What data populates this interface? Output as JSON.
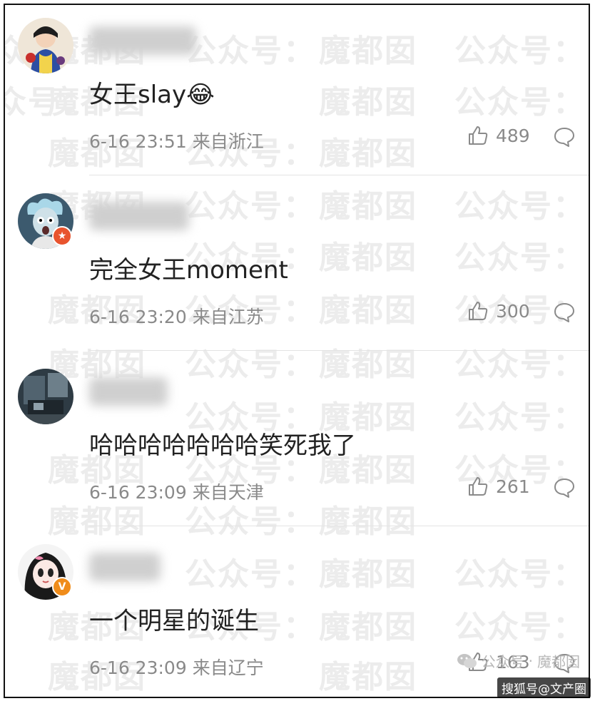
{
  "watermark": {
    "text_a": "魔都囡",
    "text_b": "公众号："
  },
  "comments": [
    {
      "text": "女王slay😂",
      "date": "6-16 23:51",
      "location": "来自浙江",
      "likes": "489",
      "badge": ""
    },
    {
      "text": "完全女王moment",
      "date": "6-16 23:20",
      "location": "来自江苏",
      "likes": "300",
      "badge": "★"
    },
    {
      "text": "哈哈哈哈哈哈哈笑死我了",
      "date": "6-16 23:09",
      "location": "来自天津",
      "likes": "261",
      "badge": ""
    },
    {
      "text": "一个明星的诞生",
      "date": "6-16 23:09",
      "location": "来自辽宁",
      "likes": "163",
      "badge": "V"
    }
  ],
  "footer": {
    "account_label": "公众号",
    "account_name": "魔都囡",
    "source": "搜狐号@文产圈"
  },
  "colors": {
    "badge_red": "#e8542e",
    "badge_orange": "#f08c1a",
    "text_main": "#222222",
    "text_meta": "#8a8a8a"
  },
  "icons": [
    "thumbs-up-icon",
    "comment-bubble-icon",
    "wechat-icon"
  ]
}
